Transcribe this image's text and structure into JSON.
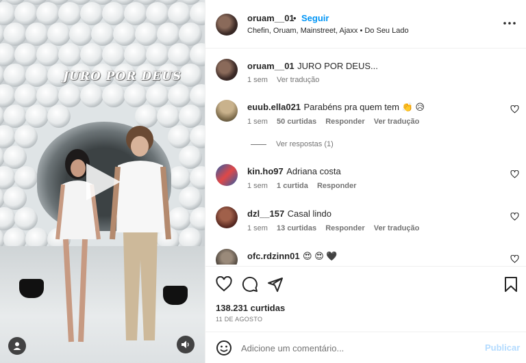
{
  "media": {
    "overlay_title": "JURO POR DEUS",
    "icons": {
      "play": "play-icon",
      "user_tags": "user-tag-icon",
      "mute": "speaker-icon"
    }
  },
  "header": {
    "username": "oruam__01",
    "separator": "•",
    "follow_label": "Seguir",
    "subtitle": "Chefin, Oruam, Mainstreet, Ajaxx • Do Seu Lado",
    "more_icon": "more-horizontal-icon"
  },
  "caption": {
    "username": "oruam__01",
    "text": "JURO POR DEUS...",
    "time": "1 sem",
    "translate": "Ver tradução"
  },
  "comments": [
    {
      "username": "euub.ella021",
      "text": "Parabéns pra quem tem 👏 😥",
      "time": "1 sem",
      "likes": "50 curtidas",
      "reply": "Responder",
      "translate": "Ver tradução"
    },
    {
      "username": "kin.ho97",
      "text": "Adriana costa",
      "time": "1 sem",
      "likes": "1 curtida",
      "reply": "Responder",
      "translate": ""
    },
    {
      "username": "dzl__157",
      "text": "Casal lindo",
      "time": "1 sem",
      "likes": "13 curtidas",
      "reply": "Responder",
      "translate": "Ver tradução"
    },
    {
      "username": "ofc.rdzinn01",
      "text": "😍 😍 🖤",
      "time": "",
      "likes": "",
      "reply": "",
      "translate": ""
    }
  ],
  "replies_label": "Ver respostas (1)",
  "actions": {
    "likes": "138.231 curtidas",
    "date": "11 DE AGOSTO",
    "icons": [
      "heart-icon",
      "comment-icon",
      "share-icon",
      "bookmark-icon"
    ]
  },
  "add_comment": {
    "placeholder": "Adicione um comentário...",
    "publish_label": "Publicar",
    "emoji_icon": "emoji-icon"
  },
  "colors": {
    "accent": "#0095f6",
    "muted": "#737373",
    "publish_disabled": "#b3dbff",
    "text": "#262626"
  }
}
